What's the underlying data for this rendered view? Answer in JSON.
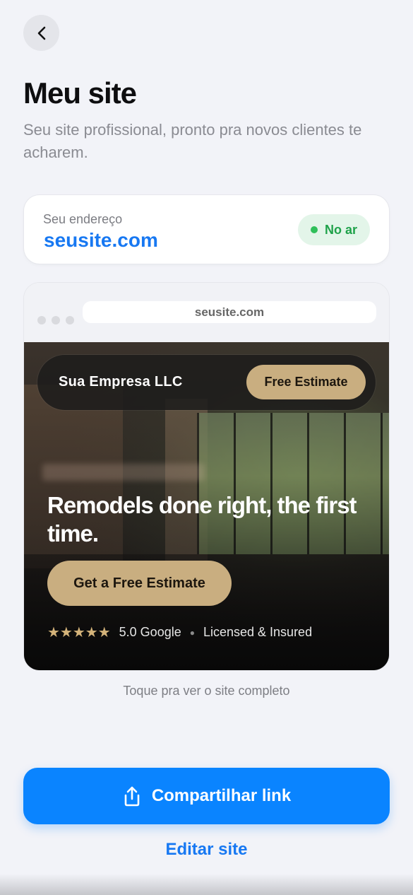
{
  "header": {
    "back_icon": "chevron-left-icon",
    "title": "Meu site",
    "subtitle": "Seu site profissional, pronto pra novos clientes te acharem."
  },
  "address_card": {
    "label": "Seu endereço",
    "value": "seusite.com",
    "status": "No ar",
    "status_color": "#2fc05a"
  },
  "preview": {
    "url": "seusite.com",
    "brand": "Sua Empresa LLC",
    "nav_cta": "Free Estimate",
    "headline": "Remodels done right, the first time.",
    "hero_cta": "Get a Free Estimate",
    "stars": "★★★★★",
    "rating": "5.0 Google",
    "badge": "Licensed & Insured",
    "accent_color": "#c9ae80",
    "hint": "Toque pra ver o site completo"
  },
  "actions": {
    "share_icon": "share-icon",
    "share_label": "Compartilhar link",
    "edit_label": "Editar site",
    "primary_color": "#0a84ff"
  }
}
